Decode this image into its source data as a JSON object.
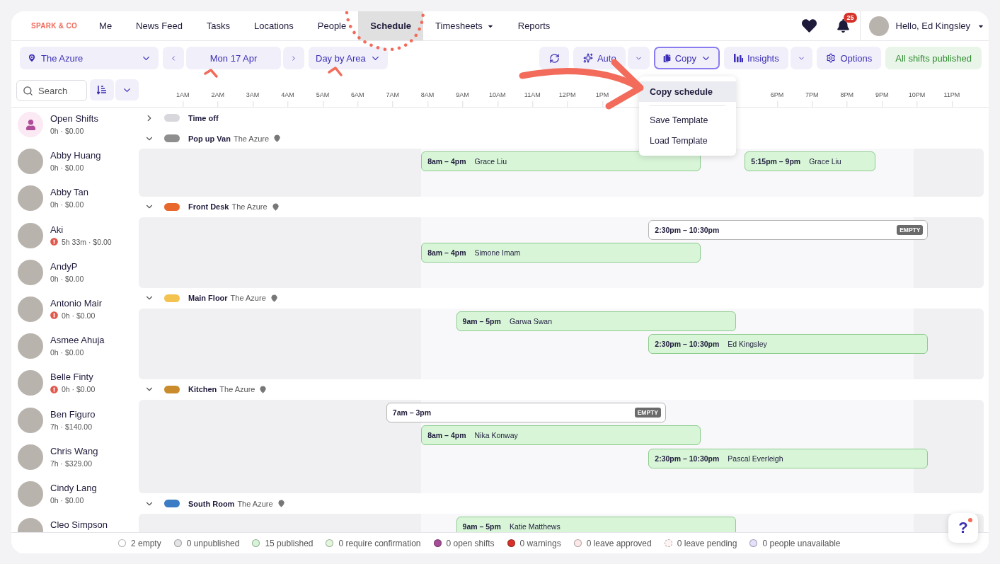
{
  "nav": {
    "logo": "SPARK & CO",
    "items": [
      {
        "label": "Me",
        "selected": false,
        "dropdown": false
      },
      {
        "label": "News Feed",
        "selected": false,
        "dropdown": false
      },
      {
        "label": "Tasks",
        "selected": false,
        "dropdown": false
      },
      {
        "label": "Locations",
        "selected": false,
        "dropdown": false
      },
      {
        "label": "People",
        "selected": false,
        "dropdown": false
      },
      {
        "label": "Schedule",
        "selected": true,
        "dropdown": false
      },
      {
        "label": "Timesheets",
        "selected": false,
        "dropdown": true
      },
      {
        "label": "Reports",
        "selected": false,
        "dropdown": false
      }
    ],
    "notifications": "25",
    "greeting": "Hello, Ed Kingsley"
  },
  "toolbar": {
    "location": "The Azure",
    "date": "Mon 17 Apr",
    "view": "Day by Area",
    "auto": "Auto",
    "copy": "Copy",
    "insights": "Insights",
    "options": "Options",
    "status": "All shifts published"
  },
  "copy_menu": [
    {
      "label": "Copy schedule",
      "selected": true
    },
    {
      "label": "Save Template",
      "selected": false
    },
    {
      "label": "Load Template",
      "selected": false
    }
  ],
  "search": {
    "placeholder": "Search"
  },
  "ticks_before": [
    "1AM",
    "2AM",
    "3AM",
    "4AM",
    "5AM",
    "6AM",
    "7AM",
    "8AM",
    "9AM",
    "10AM",
    "11AM",
    "12PM",
    "1PM"
  ],
  "ticks_after": [
    "6PM",
    "7PM",
    "8PM",
    "9PM",
    "10PM",
    "11PM"
  ],
  "people": [
    {
      "kind": "open",
      "name": "Open Shifts",
      "meta": "0h · $0.00",
      "warning": false
    },
    {
      "kind": "person",
      "name": "Abby Huang",
      "meta": "0h · $0.00",
      "warning": false
    },
    {
      "kind": "person",
      "name": "Abby Tan",
      "meta": "0h · $0.00",
      "warning": false
    },
    {
      "kind": "person",
      "name": "Aki",
      "meta": "5h 33m · $0.00",
      "warning": true
    },
    {
      "kind": "person",
      "name": "AndyP",
      "meta": "0h · $0.00",
      "warning": false
    },
    {
      "kind": "person",
      "name": "Antonio Mair",
      "meta": "0h · $0.00",
      "warning": true
    },
    {
      "kind": "person",
      "name": "Asmee Ahuja",
      "meta": "0h · $0.00",
      "warning": false
    },
    {
      "kind": "person",
      "name": "Belle Finty",
      "meta": "0h · $0.00",
      "warning": true
    },
    {
      "kind": "person",
      "name": "Ben Figuro",
      "meta": "7h · $140.00",
      "warning": false
    },
    {
      "kind": "person",
      "name": "Chris Wang",
      "meta": "7h · $329.00",
      "warning": false
    },
    {
      "kind": "person",
      "name": "Cindy Lang",
      "meta": "0h · $0.00",
      "warning": false
    },
    {
      "kind": "person",
      "name": "Cleo Simpson"
    }
  ],
  "time_off": {
    "label": "Time off",
    "expanded": false,
    "color": "#d8d8dc"
  },
  "areas": [
    {
      "name": "Pop up Van",
      "location": "The Azure",
      "expanded": true,
      "color": "#8e8e8e",
      "lanes": [
        {
          "shifts": [
            {
              "kind": "assigned",
              "time": "8am – 4pm",
              "name": "Grace Liu"
            },
            {
              "kind": "assigned",
              "time": "5:15pm – 9pm",
              "name": "Grace Liu"
            }
          ]
        }
      ]
    },
    {
      "name": "Front Desk",
      "location": "The Azure",
      "expanded": true,
      "color": "#e8672a",
      "lanes": [
        {
          "shifts": [
            {
              "kind": "empty",
              "time": "2:30pm – 10:30pm",
              "badge": "EMPTY"
            }
          ]
        },
        {
          "shifts": [
            {
              "kind": "assigned",
              "time": "8am – 4pm",
              "name": "Simone Imam"
            }
          ]
        }
      ]
    },
    {
      "name": "Main Floor",
      "location": "The Azure",
      "expanded": true,
      "color": "#f4c24f",
      "lanes": [
        {
          "shifts": [
            {
              "kind": "assigned",
              "time": "9am – 5pm",
              "name": "Garwa Swan"
            }
          ]
        },
        {
          "shifts": [
            {
              "kind": "assigned",
              "time": "2:30pm – 10:30pm",
              "name": "Ed Kingsley"
            }
          ]
        }
      ]
    },
    {
      "name": "Kitchen",
      "location": "The Azure",
      "expanded": true,
      "color": "#c98b2b",
      "lanes": [
        {
          "shifts": [
            {
              "kind": "empty",
              "time": "7am – 3pm",
              "badge": "EMPTY"
            }
          ]
        },
        {
          "shifts": [
            {
              "kind": "assigned",
              "time": "8am – 4pm",
              "name": "Nika Konway"
            }
          ]
        },
        {
          "shifts": [
            {
              "kind": "assigned",
              "time": "2:30pm – 10:30pm",
              "name": "Pascal Everleigh"
            }
          ]
        }
      ]
    },
    {
      "name": "South Room",
      "location": "The Azure",
      "expanded": true,
      "color": "#3b7cc4",
      "lanes": [
        {
          "shifts": [
            {
              "kind": "assigned",
              "time": "9am – 5pm",
              "name": "Katie Matthews"
            }
          ]
        }
      ]
    }
  ],
  "legend": [
    {
      "label": "2 empty",
      "color": "#ffffff",
      "kind": "solid"
    },
    {
      "label": "0 unpublished",
      "color": "#e4e4e6",
      "kind": "solid"
    },
    {
      "label": "15 published",
      "color": "#d6f5d6",
      "kind": "solid"
    },
    {
      "label": "0 require confirmation",
      "color": "#e2f7dc",
      "kind": "solid"
    },
    {
      "label": "0 open shifts",
      "color": "#a64d98",
      "kind": "solid"
    },
    {
      "label": "0 warnings",
      "color": "#d5332a",
      "kind": "solid"
    },
    {
      "label": "0 leave approved",
      "color": "#fde8e8",
      "kind": "solid"
    },
    {
      "label": "0 leave pending",
      "color": "#fff4f4",
      "kind": "dashed"
    },
    {
      "label": "0 people unavailable",
      "color": "#e6e0fb",
      "kind": "solid"
    }
  ],
  "help": "?"
}
